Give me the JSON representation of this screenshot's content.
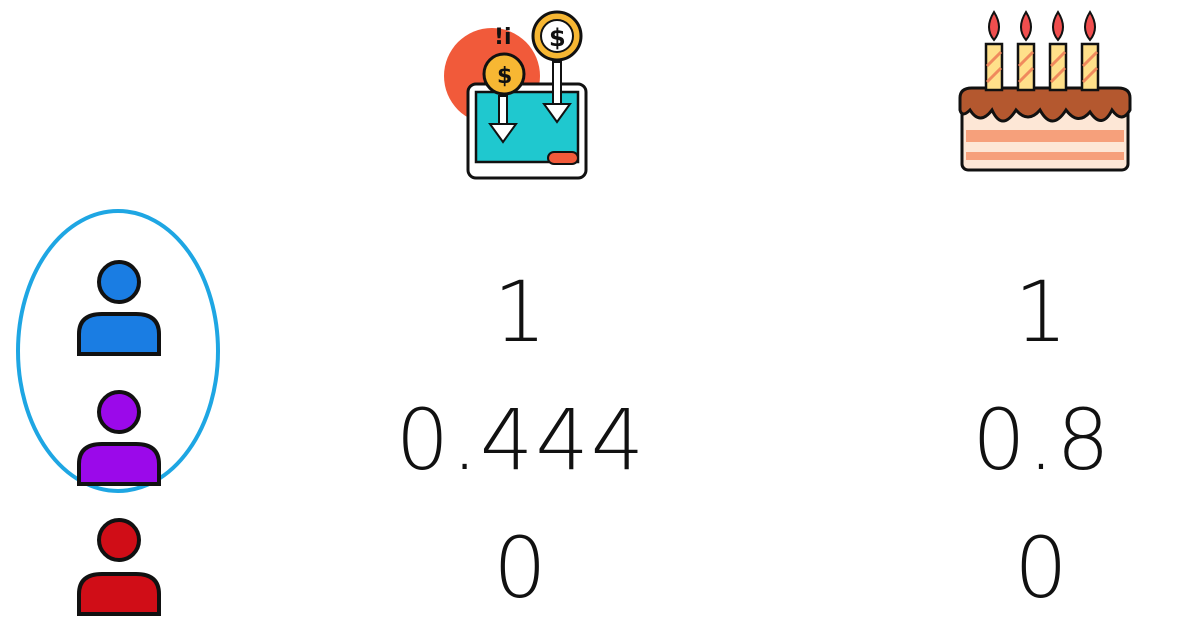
{
  "columns": [
    {
      "icon": "payment-card-icon"
    },
    {
      "icon": "birthday-cake-icon"
    }
  ],
  "rows": [
    {
      "icon": "user-icon",
      "color": "#1a7de3",
      "values": [
        "1",
        "1"
      ]
    },
    {
      "icon": "user-icon",
      "color": "#9b09ea",
      "values": [
        "0.444",
        "0.8"
      ]
    },
    {
      "icon": "user-icon",
      "color": "#d00d17",
      "values": [
        "0",
        "0"
      ]
    }
  ],
  "highlight": {
    "color": "#1ea6e3"
  }
}
